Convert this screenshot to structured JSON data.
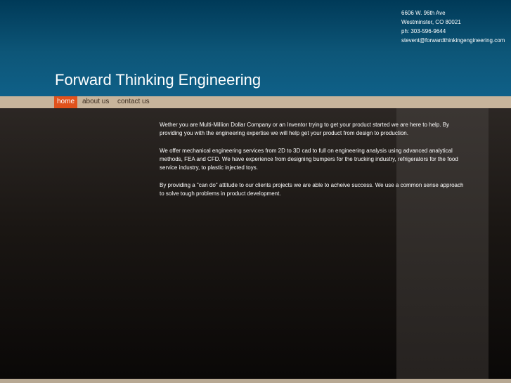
{
  "header": {
    "site_title": "Forward Thinking Engineering",
    "contact": {
      "address_line1": "6606 W. 96th Ave",
      "address_line2": "Westminster, CO 80021",
      "phone": "ph: 303-596-9644",
      "email": "stevent@forwardthinkingengineering.com"
    }
  },
  "nav": {
    "items": [
      {
        "label": "home",
        "active": true
      },
      {
        "label": "about us",
        "active": false
      },
      {
        "label": "contact us",
        "active": false
      }
    ]
  },
  "main": {
    "paragraphs": [
      "Wether you are Multi-Million Dollar Company or an Inventor trying to get your product started we are here to help.  By providing you with the engineering expertise we will help get your product from design to production.",
      "We offer mechanical engineering services from 2D to 3D cad to full on engineering analysis using advanced analytical methods, FEA and CFD.  We have experience from designing bumpers for the trucking industry, refrigerators for the food service industry, to plastic injected toys.",
      "By providing a \"can do\" attitude to our clients projects we are able to acheive success.  We use a common sense approach to solve tough problems in product development."
    ]
  },
  "colors": {
    "header_blue": "#0d5678",
    "nav_tan": "#c7b49b",
    "nav_active": "#e0521c",
    "content_dark": "#1a1613",
    "side_column": "#2e2a27"
  }
}
